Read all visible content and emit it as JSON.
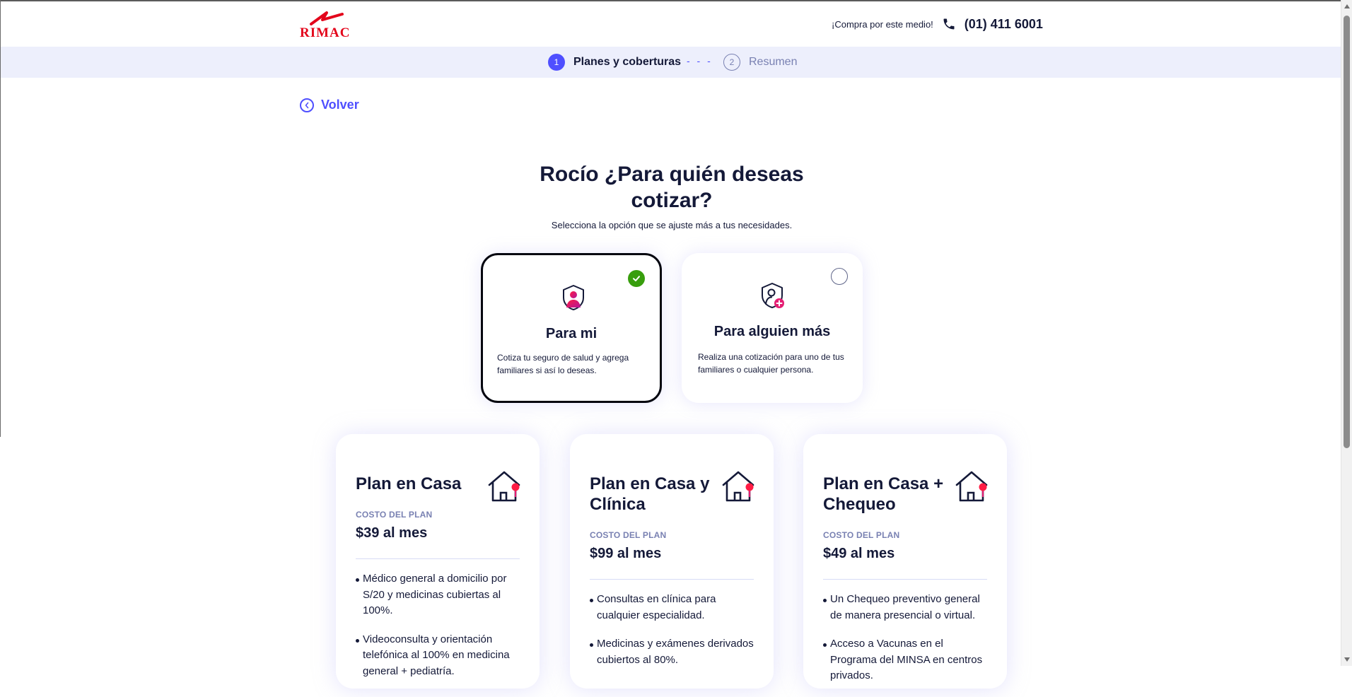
{
  "header": {
    "brand": "RIMAC",
    "cta_text": "¡Compra por este medio!",
    "phone": "(01) 411 6001"
  },
  "steps": [
    {
      "number": "1",
      "label": "Planes y coberturas",
      "active": true
    },
    {
      "number": "2",
      "label": "Resumen",
      "active": false
    }
  ],
  "back_label": "Volver",
  "main": {
    "title": "Rocío ¿Para quién deseas cotizar?",
    "subtitle": "Selecciona la opción que se ajuste más a tus necesidades."
  },
  "options": [
    {
      "title": "Para mi",
      "description": "Cotiza tu seguro de salud y agrega familiares si así lo deseas.",
      "selected": true,
      "icon": "shield-user-icon"
    },
    {
      "title": "Para alguien más",
      "description": "Realiza una cotización para uno de tus familiares o cualquier persona.",
      "selected": false,
      "icon": "shield-user-add-icon"
    }
  ],
  "plans": [
    {
      "title": "Plan en Casa",
      "cost_label": "COSTO DEL PLAN",
      "price": "$39 al mes",
      "features": [
        "Médico general a domicilio por S/20 y medicinas cubiertas al 100%.",
        "Videoconsulta y orientación telefónica al 100% en medicina general + pediatría."
      ]
    },
    {
      "title": "Plan en Casa y Clínica",
      "cost_label": "COSTO DEL PLAN",
      "price": "$99 al mes",
      "features": [
        "Consultas en clínica para cualquier especialidad.",
        "Medicinas y exámenes derivados cubiertos al 80%."
      ]
    },
    {
      "title": "Plan en Casa + Chequeo",
      "cost_label": "COSTO DEL PLAN",
      "price": "$49 al mes",
      "features": [
        "Un Chequeo preventivo general de manera presencial o virtual.",
        "Acceso a Vacunas en el Programa del MINSA en centros privados."
      ]
    }
  ],
  "colors": {
    "brand_red": "#e3051b",
    "accent_blue": "#4f4fff",
    "text_dark": "#141938",
    "muted": "#7981b2",
    "stepbar_bg": "#edeffc",
    "success_green": "#389e0d",
    "pink": "#ff1c44"
  }
}
